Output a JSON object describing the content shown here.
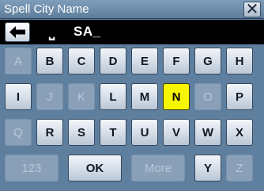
{
  "header": {
    "title": "Spell City Name",
    "close_label": "✕"
  },
  "entry": {
    "space_symbol": "⎵",
    "text": "SA_"
  },
  "keyboard": {
    "row1": [
      {
        "label": "A",
        "state": "disabled"
      },
      {
        "label": "B",
        "state": "enabled"
      },
      {
        "label": "C",
        "state": "enabled"
      },
      {
        "label": "D",
        "state": "enabled"
      },
      {
        "label": "E",
        "state": "enabled"
      },
      {
        "label": "F",
        "state": "enabled"
      },
      {
        "label": "G",
        "state": "enabled"
      },
      {
        "label": "H",
        "state": "enabled"
      }
    ],
    "row2": [
      {
        "label": "I",
        "state": "enabled"
      },
      {
        "label": "J",
        "state": "disabled"
      },
      {
        "label": "K",
        "state": "disabled"
      },
      {
        "label": "L",
        "state": "enabled"
      },
      {
        "label": "M",
        "state": "enabled"
      },
      {
        "label": "N",
        "state": "highlighted"
      },
      {
        "label": "O",
        "state": "disabled"
      },
      {
        "label": "P",
        "state": "enabled"
      }
    ],
    "row3": [
      {
        "label": "Q",
        "state": "disabled"
      },
      {
        "label": "R",
        "state": "enabled"
      },
      {
        "label": "S",
        "state": "enabled"
      },
      {
        "label": "T",
        "state": "enabled"
      },
      {
        "label": "U",
        "state": "enabled"
      },
      {
        "label": "V",
        "state": "enabled"
      },
      {
        "label": "W",
        "state": "enabled"
      },
      {
        "label": "X",
        "state": "enabled"
      }
    ],
    "row4": [
      {
        "label": "123",
        "state": "disabled"
      },
      {
        "label": "OK",
        "state": "enabled"
      },
      {
        "label": "More",
        "state": "disabled"
      },
      {
        "label": "Y",
        "state": "enabled"
      },
      {
        "label": "Z",
        "state": "disabled"
      }
    ]
  },
  "colors": {
    "highlight": "#f7f500",
    "background": "#5f7f9f"
  }
}
